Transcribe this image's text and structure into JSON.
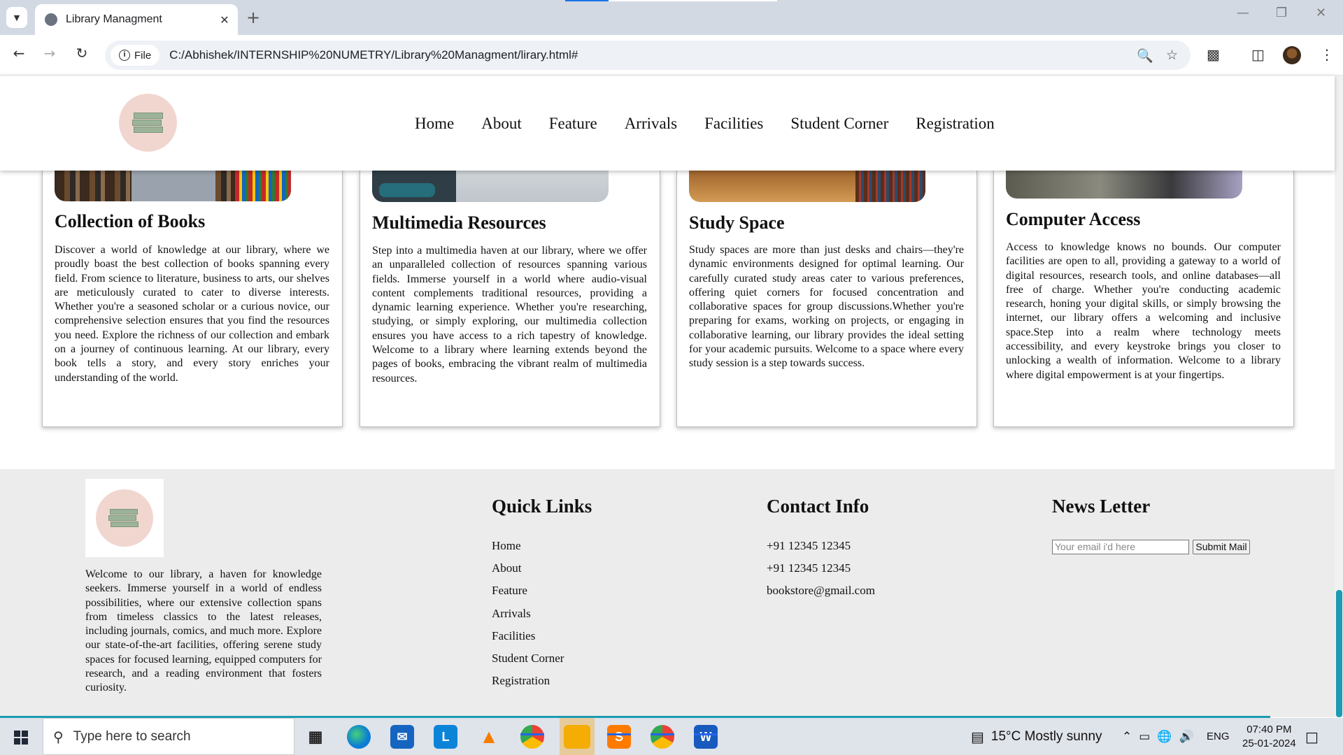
{
  "browser": {
    "tab_title": "Library Managment",
    "url_chip": "File",
    "url": "C:/Abhishek/INTERNSHIP%20NUMETRY/Library%20Managment/lirary.html#"
  },
  "site": {
    "nav": [
      "Home",
      "About",
      "Feature",
      "Arrivals",
      "Facilities",
      "Student Corner",
      "Registration"
    ]
  },
  "cards": [
    {
      "title": "Collection of Books",
      "text": "Discover a world of knowledge at our library, where we proudly boast the best collection of books spanning every field. From science to literature, business to arts, our shelves are meticulously curated to cater to diverse interests. Whether you're a seasoned scholar or a curious novice, our comprehensive selection ensures that you find the resources you need. Explore the richness of our collection and embark on a journey of continuous learning. At our library, every book tells a story, and every story enriches your understanding of the world."
    },
    {
      "title": "Multimedia Resources",
      "text": "Step into a multimedia haven at our library, where we offer an unparalleled collection of resources spanning various fields. Immerse yourself in a world where audio-visual content complements traditional resources, providing a dynamic learning experience. Whether you're researching, studying, or simply exploring, our multimedia collection ensures you have access to a rich tapestry of knowledge. Welcome to a library where learning extends beyond the pages of books, embracing the vibrant realm of multimedia resources."
    },
    {
      "title": "Study Space",
      "text": "Study spaces are more than just desks and chairs—they're dynamic environments designed for optimal learning. Our carefully curated study areas cater to various preferences, offering quiet corners for focused concentration and collaborative spaces for group discussions.Whether you're preparing for exams, working on projects, or engaging in collaborative learning, our library provides the ideal setting for your academic pursuits. Welcome to a space where every study session is a step towards success."
    },
    {
      "title": "Computer Access",
      "text": "Access to knowledge knows no bounds. Our computer facilities are open to all, providing a gateway to a world of digital resources, research tools, and online databases—all free of charge. Whether you're conducting academic research, honing your digital skills, or simply browsing the internet, our library offers a welcoming and inclusive space.Step into a realm where technology meets accessibility, and every keystroke brings you closer to unlocking a wealth of information. Welcome to a library where digital empowerment is at your fingertips."
    }
  ],
  "footer": {
    "about": "Welcome to our library, a haven for knowledge seekers. Immerse yourself in a world of endless possibilities, where our extensive collection spans from timeless classics to the latest releases, including journals, comics, and much more. Explore our state-of-the-art facilities, offering serene study spaces for focused learning, equipped computers for research, and a reading environment that fosters curiosity.",
    "quick_links_title": "Quick Links",
    "quick_links": [
      "Home",
      "About",
      "Feature",
      "Arrivals",
      "Facilities",
      "Student Corner",
      "Registration"
    ],
    "contact_title": "Contact Info",
    "contacts": [
      "+91 12345 12345",
      "+91 12345 12345",
      "bookstore@gmail.com"
    ],
    "newsletter_title": "News Letter",
    "newsletter_placeholder": "Your email i'd here",
    "newsletter_button": "Submit Mail"
  },
  "taskbar": {
    "search_placeholder": "Type here to search",
    "weather": "15°C  Mostly sunny",
    "lang": "ENG",
    "time": "07:40 PM",
    "date": "25-01-2024"
  }
}
